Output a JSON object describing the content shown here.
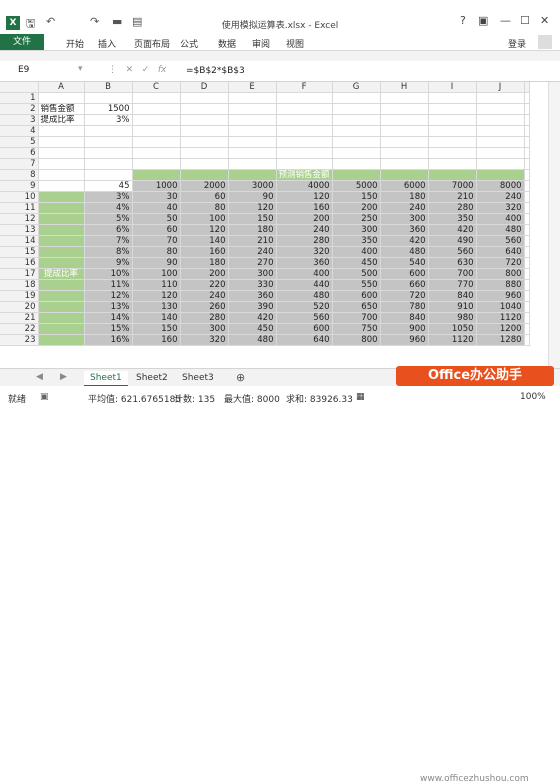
{
  "window": {
    "title": "使用模拟运算表.xlsx - Excel",
    "controls": [
      "?",
      "▣",
      "—",
      "☐",
      "✕"
    ]
  },
  "ribbon": {
    "file": "文件",
    "tabs": [
      "开始",
      "插入",
      "页面布局",
      "公式",
      "数据",
      "审阅",
      "视图"
    ],
    "login": "登录"
  },
  "formula_bar": {
    "name_box": "E9",
    "formula": "=$B$2*$B$3"
  },
  "grid": {
    "columns": [
      "A",
      "B",
      "C",
      "D",
      "E",
      "F",
      "G",
      "H",
      "I",
      "J"
    ],
    "rows": [
      1,
      2,
      3,
      4,
      5,
      6,
      7,
      8,
      9,
      10,
      11,
      12,
      13,
      14,
      15,
      16,
      17,
      18,
      19,
      20,
      21,
      22,
      23
    ],
    "a2": "销售金额",
    "b2": "1500",
    "a3": "提成比率",
    "b3": "3%",
    "group_title": "预测销售金额",
    "side_label": "提成比率",
    "b9": "45",
    "header_values": [
      "1000",
      "2000",
      "3000",
      "4000",
      "5000",
      "6000",
      "7000",
      "8000"
    ],
    "rates": [
      "3%",
      "4%",
      "5%",
      "6%",
      "7%",
      "8%",
      "9%",
      "10%",
      "11%",
      "12%",
      "13%",
      "14%",
      "15%",
      "16%"
    ],
    "values": [
      [
        "30",
        "60",
        "90",
        "120",
        "150",
        "180",
        "210",
        "240"
      ],
      [
        "40",
        "80",
        "120",
        "160",
        "200",
        "240",
        "280",
        "320"
      ],
      [
        "50",
        "100",
        "150",
        "200",
        "250",
        "300",
        "350",
        "400"
      ],
      [
        "60",
        "120",
        "180",
        "240",
        "300",
        "360",
        "420",
        "480"
      ],
      [
        "70",
        "140",
        "210",
        "280",
        "350",
        "420",
        "490",
        "560"
      ],
      [
        "80",
        "160",
        "240",
        "320",
        "400",
        "480",
        "560",
        "640"
      ],
      [
        "90",
        "180",
        "270",
        "360",
        "450",
        "540",
        "630",
        "720"
      ],
      [
        "100",
        "200",
        "300",
        "400",
        "500",
        "600",
        "700",
        "800"
      ],
      [
        "110",
        "220",
        "330",
        "440",
        "550",
        "660",
        "770",
        "880"
      ],
      [
        "120",
        "240",
        "360",
        "480",
        "600",
        "720",
        "840",
        "960"
      ],
      [
        "130",
        "260",
        "390",
        "520",
        "650",
        "780",
        "910",
        "1040"
      ],
      [
        "140",
        "280",
        "420",
        "560",
        "700",
        "840",
        "980",
        "1120"
      ],
      [
        "150",
        "300",
        "450",
        "600",
        "750",
        "900",
        "1050",
        "1200"
      ],
      [
        "160",
        "320",
        "480",
        "640",
        "800",
        "960",
        "1120",
        "1280"
      ]
    ]
  },
  "sheets": [
    "Sheet1",
    "Sheet2",
    "Sheet3"
  ],
  "status": {
    "ready": "就绪",
    "average": "平均值: 621.6765185",
    "count": "计数: 135",
    "max": "最大值: 8000",
    "sum": "求和: 83926.33"
  },
  "brand_badge": "Office办公助手",
  "watermark": "www.officezhushou.com",
  "zoom": "100%",
  "colors": {
    "excel_green": "#217346",
    "cell_green": "#a9d08e",
    "cell_gray": "#c4c4c4",
    "badge": "#e8501e"
  }
}
